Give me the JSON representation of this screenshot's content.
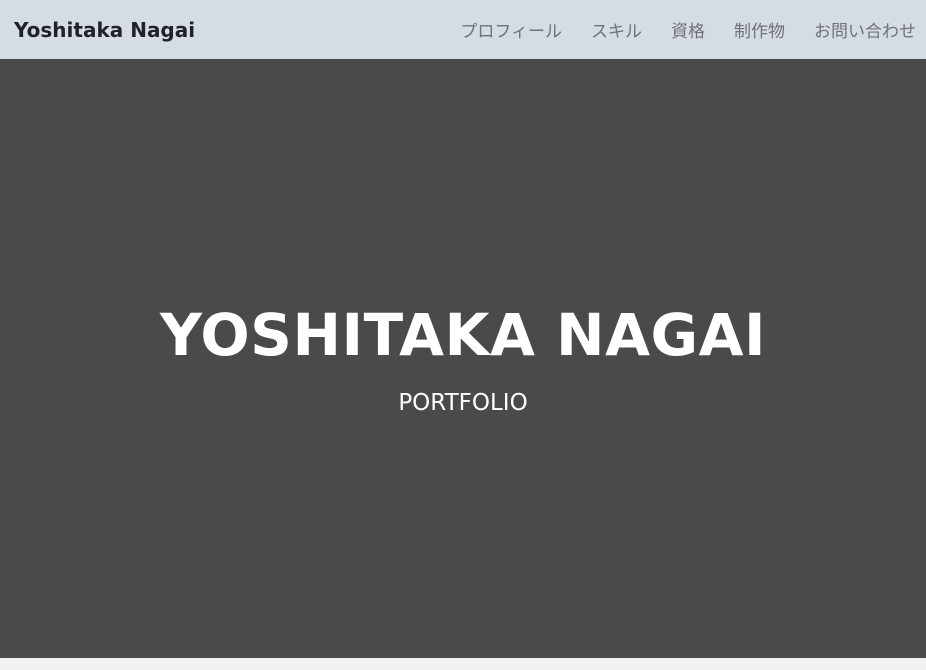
{
  "navbar": {
    "brand": "Yoshitaka Nagai",
    "links": [
      {
        "label": "プロフィール"
      },
      {
        "label": "スキル"
      },
      {
        "label": "資格"
      },
      {
        "label": "制作物"
      },
      {
        "label": "お問い合わせ"
      }
    ]
  },
  "hero": {
    "title": "YOSHITAKA NAGAI",
    "subtitle": "PORTFOLIO"
  },
  "colors": {
    "navbar_background": "#d6dce4",
    "hero_background": "#4a4a48",
    "hero_text": "#ffffff",
    "nav_link_text": "#6f7378",
    "brand_text": "#1f2226"
  }
}
